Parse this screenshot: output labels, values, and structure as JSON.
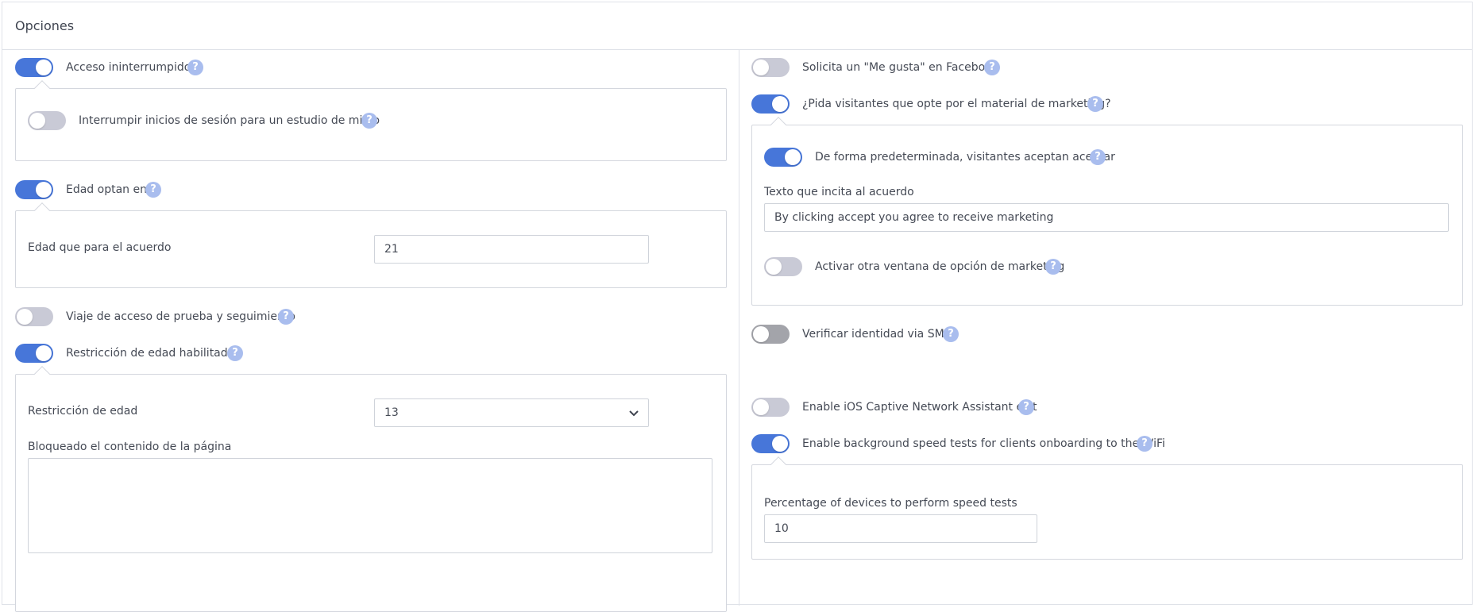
{
  "panel": {
    "title": "Opciones"
  },
  "left": {
    "uninterrupted_access": {
      "label": "Acceso ininterrumpido",
      "on": true
    },
    "interrupt_logins": {
      "label": "Interrumpir inicios de sesión para un estudio de micro",
      "on": false
    },
    "age_optin": {
      "label": "Edad optan en",
      "on": true
    },
    "age_agreement": {
      "label": "Edad que para el acuerdo",
      "value": "21"
    },
    "trial_access": {
      "label": "Viaje de acceso de prueba y seguimiento",
      "on": false
    },
    "age_restriction": {
      "label": "Restricción de edad habilitado",
      "on": true
    },
    "age_restriction_select": {
      "label": "Restricción de edad",
      "value": "13"
    },
    "blocked_content": {
      "label": "Bloqueado el contenido de la página",
      "value": ""
    }
  },
  "right": {
    "facebook_like": {
      "label": "Solicita un \"Me gusta\" en Facebook",
      "on": false
    },
    "marketing_optin": {
      "label": "¿Pida visitantes que opte por el material de marketing?",
      "on": true
    },
    "default_accept": {
      "label": "De forma predeterminada, visitantes aceptan aceptar",
      "on": true
    },
    "agreement_text": {
      "label": "Texto que incita al acuerdo",
      "value": "By clicking accept you agree to receive marketing"
    },
    "other_marketing_window": {
      "label": "Activar otra ventana de opción de marketing",
      "on": false
    },
    "sms_verify": {
      "label": "Verificar identidad via SMS",
      "on": false
    },
    "ios_cna_exit": {
      "label": "Enable iOS Captive Network Assistant exit",
      "on": false
    },
    "speed_tests": {
      "label": "Enable background speed tests for clients onboarding to the WiFi",
      "on": true
    },
    "speed_test_pct": {
      "label": "Percentage of devices to perform speed tests",
      "value": "10"
    }
  },
  "help_glyph": "?",
  "colors": {
    "toggle_on": "#4776d9",
    "toggle_off": "#c9cad6",
    "toggle_disabled": "#a3a4aa",
    "help": "#a9bdee"
  },
  "icons": {
    "help": "question-circle-icon",
    "select": "chevron-down-icon"
  }
}
